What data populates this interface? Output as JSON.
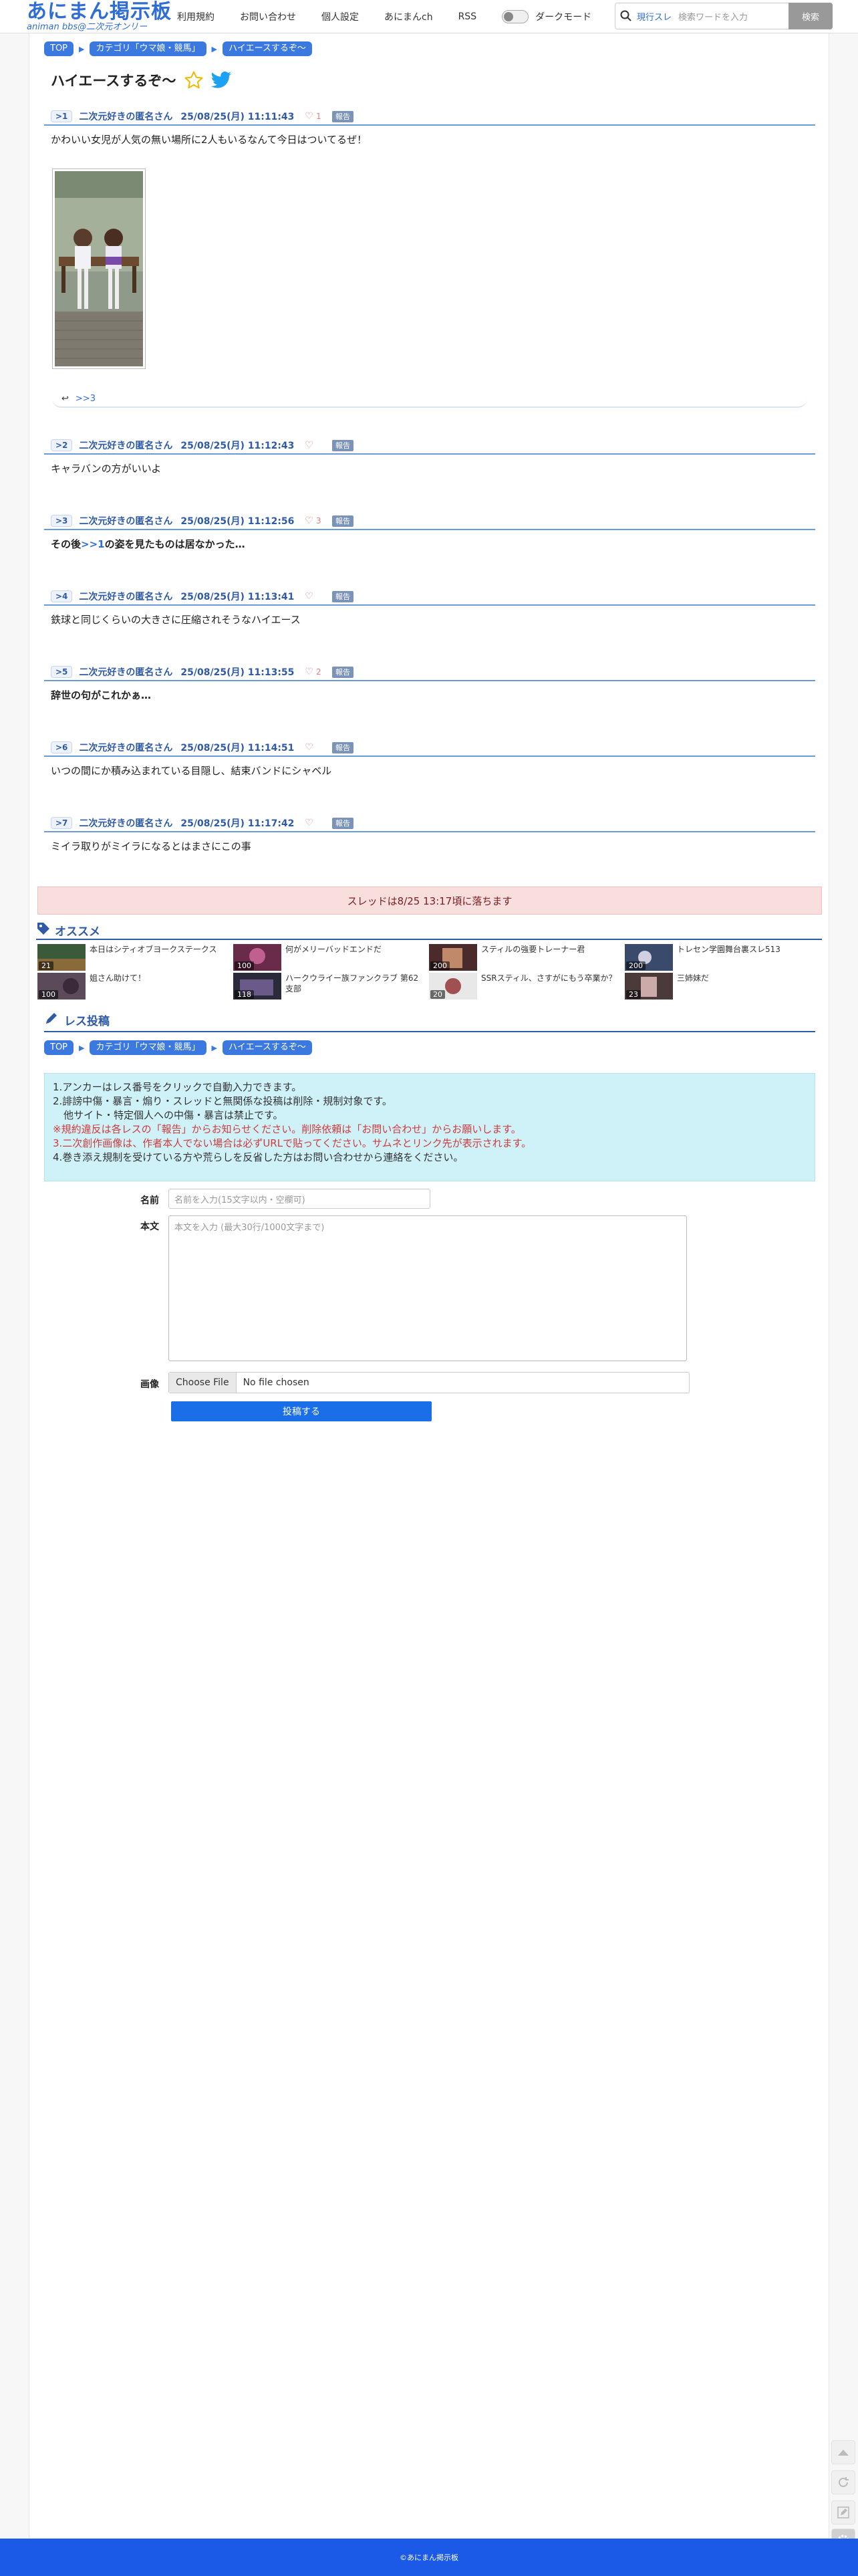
{
  "header": {
    "logo_main": "あにまん掲示板",
    "logo_sub": "animan bbs@二次元オンリー",
    "nav": [
      "利用規約",
      "お問い合わせ",
      "個人設定",
      "あにまんch",
      "RSS"
    ],
    "dark_mode_label": "ダークモード",
    "search_mode": "現行スレ",
    "search_placeholder": "検索ワードを入力",
    "search_button": "検索"
  },
  "breadcrumb": [
    "TOP",
    "カテゴリ「ウマ娘・競馬」",
    "ハイエースするぞ〜"
  ],
  "thread": {
    "title": "ハイエースするぞ〜"
  },
  "posts": [
    {
      "no": ">1",
      "name": "二次元好きの匿名さん",
      "date": "25/08/25(月) 11:11:43",
      "likes": "1",
      "report": "報告",
      "body": "かわいい女児が人気の無い場所に2人もいるなんて今日はついてるぜ！",
      "reply": ">>3"
    },
    {
      "no": ">2",
      "name": "二次元好きの匿名さん",
      "date": "25/08/25(月) 11:12:43",
      "likes": "",
      "report": "報告",
      "body": "キャラバンの方がいいよ"
    },
    {
      "no": ">3",
      "name": "二次元好きの匿名さん",
      "date": "25/08/25(月) 11:12:56",
      "likes": "3",
      "report": "報告",
      "body_pre": "その後",
      "body_anchor": ">>1",
      "body_post": "の姿を見たものは居なかった…"
    },
    {
      "no": ">4",
      "name": "二次元好きの匿名さん",
      "date": "25/08/25(月) 11:13:41",
      "likes": "",
      "report": "報告",
      "body": "鉄球と同じくらいの大きさに圧縮されそうなハイエース"
    },
    {
      "no": ">5",
      "name": "二次元好きの匿名さん",
      "date": "25/08/25(月) 11:13:55",
      "likes": "2",
      "report": "報告",
      "body": "辞世の句がこれかぁ…"
    },
    {
      "no": ">6",
      "name": "二次元好きの匿名さん",
      "date": "25/08/25(月) 11:14:51",
      "likes": "",
      "report": "報告",
      "body": "いつの間にか積み込まれている目隠し、結束バンドにシャベル"
    },
    {
      "no": ">7",
      "name": "二次元好きの匿名さん",
      "date": "25/08/25(月) 11:17:42",
      "likes": "",
      "report": "報告",
      "body": "ミイラ取りがミイラになるとはまさにこの事"
    }
  ],
  "fallen_notice": "スレッドは8/25 13:17頃に落ちます",
  "recommend": {
    "title": "オススメ",
    "items": [
      {
        "text": "本日はシティオブヨークステークス",
        "count": "21"
      },
      {
        "text": "何がメリーバッドエンドだ",
        "count": "100"
      },
      {
        "text": "スティルの強要トレーナー君",
        "count": "200"
      },
      {
        "text": "トレセン学園舞台裏スレ513",
        "count": "200"
      },
      {
        "text": "姐さん助けて！",
        "count": "100"
      },
      {
        "text": "ハークウライー族ファンクラブ 第62支部",
        "count": "118"
      },
      {
        "text": "SSRスティル、さすがにもう卒業か？",
        "count": "20"
      },
      {
        "text": "三姉妹だ",
        "count": "23"
      }
    ]
  },
  "post_form": {
    "title": "レス投稿",
    "notice": [
      "1.アンカーはレス番号をクリックで自動入力できます。",
      "2.誹謗中傷・暴言・煽り・スレッドと無関係な投稿は削除・規制対象です。",
      "他サイト・特定個人への中傷・暴言は禁止です。",
      "※規約違反は各レスの「報告」からお知らせください。削除依頼は「お問い合わせ」からお願いします。",
      "3.二次創作画像は、作者本人でない場合は必ずURLで貼ってください。サムネとリンク先が表示されます。",
      "4.巻き添え規制を受けている方や荒らしを反省した方はお問い合わせから連絡をください。"
    ],
    "name_label": "名前",
    "name_placeholder": "名前を入力(15文字以内・空欄可)",
    "body_label": "本文",
    "body_placeholder": "本文を入力 (最大30行/1000文字まで)",
    "image_label": "画像",
    "file_button": "Choose File",
    "file_status": "No file chosen",
    "submit": "投稿する"
  },
  "footer": "©あにまん掲示板",
  "colors": {
    "brand": "#2f6dd6",
    "fallen_bg": "#f9dede",
    "notice_bg": "#cff2f9",
    "footer": "#1a5ae6"
  }
}
